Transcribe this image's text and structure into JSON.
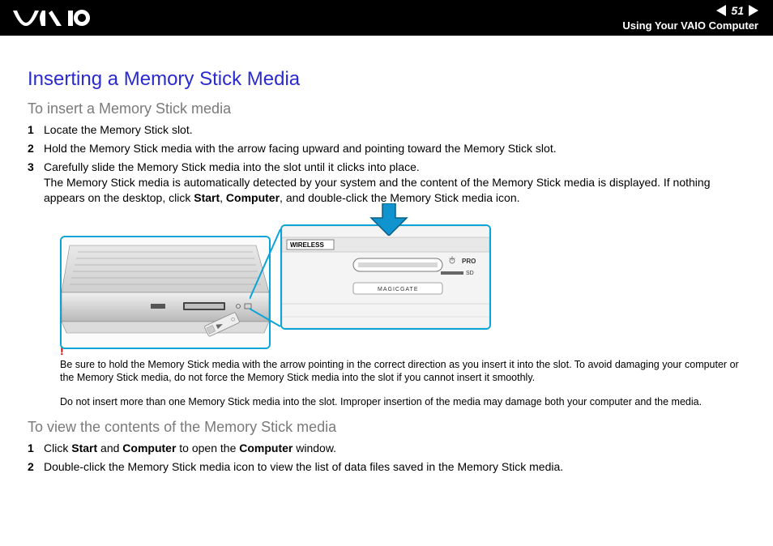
{
  "header": {
    "page_number": "51",
    "section": "Using Your VAIO Computer"
  },
  "title": "Inserting a Memory Stick Media",
  "section_insert": {
    "heading": "To insert a Memory Stick media",
    "steps": [
      {
        "n": "1",
        "text": "Locate the Memory Stick slot."
      },
      {
        "n": "2",
        "text": "Hold the Memory Stick media with the arrow facing upward and pointing toward the Memory Stick slot."
      },
      {
        "n": "3",
        "text_before": "Carefully slide the Memory Stick media into the slot until it clicks into place.\nThe Memory Stick media is automatically detected by your system and the content of the Memory Stick media is displayed. If nothing appears on the desktop, click ",
        "b1": "Start",
        "mid1": ", ",
        "b2": "Computer",
        "after": ", and double-click the Memory Stick media icon."
      }
    ]
  },
  "figure": {
    "label_wireless": "WIRELESS",
    "label_pro": "PRO",
    "label_sd": "SD",
    "label_magicgate": "MAGICGATE"
  },
  "warning": {
    "mark": "!",
    "text": "Be sure to hold the Memory Stick media with the arrow pointing in the correct direction as you insert it into the slot. To avoid damaging your computer or the Memory Stick media, do not force the Memory Stick media into the slot if you cannot insert it smoothly."
  },
  "note": "Do not insert more than one Memory Stick media into the slot. Improper insertion of the media may damage both your computer and the media.",
  "section_view": {
    "heading": "To view the contents of the Memory Stick media",
    "steps": [
      {
        "n": "1",
        "pre": "Click ",
        "b1": "Start",
        "mid1": " and ",
        "b2": "Computer",
        "mid2": " to open the ",
        "b3": "Computer",
        "after": " window."
      },
      {
        "n": "2",
        "text": "Double-click the Memory Stick media icon to view the list of data files saved in the Memory Stick media."
      }
    ]
  }
}
